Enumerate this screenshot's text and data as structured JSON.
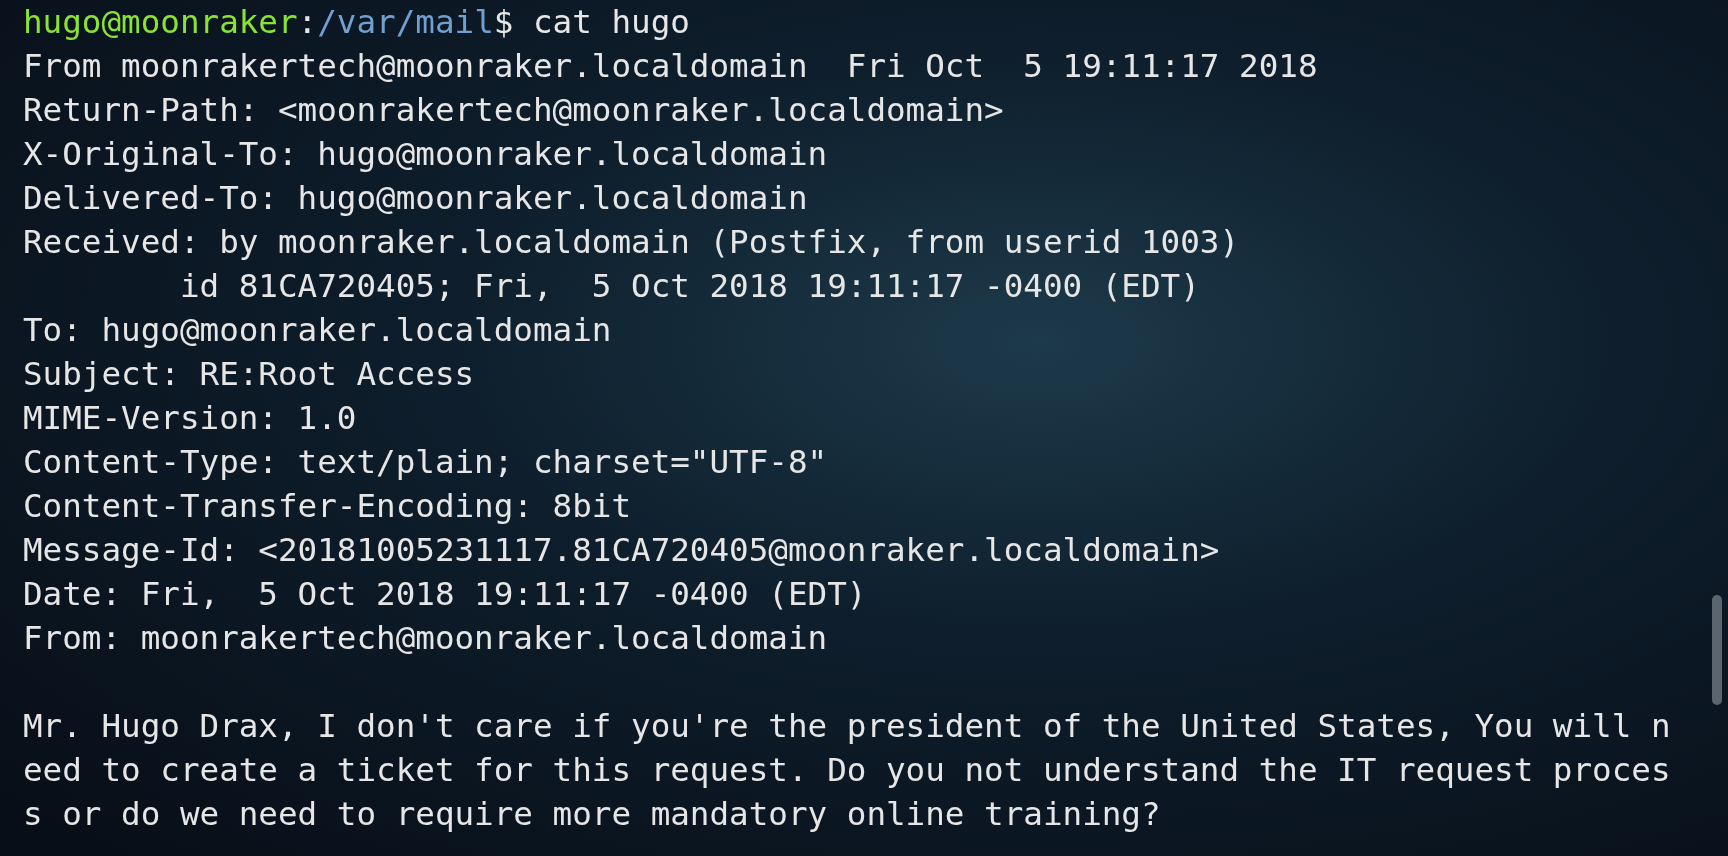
{
  "prompt": {
    "user_host": "hugo@moonraker",
    "separator": ":",
    "path": "/var/mail",
    "symbol": "$",
    "command": "cat hugo"
  },
  "output_lines": [
    "From moonrakertech@moonraker.localdomain  Fri Oct  5 19:11:17 2018",
    "Return-Path: <moonrakertech@moonraker.localdomain>",
    "X-Original-To: hugo@moonraker.localdomain",
    "Delivered-To: hugo@moonraker.localdomain",
    "Received: by moonraker.localdomain (Postfix, from userid 1003)",
    "        id 81CA720405; Fri,  5 Oct 2018 19:11:17 -0400 (EDT)",
    "To: hugo@moonraker.localdomain",
    "Subject: RE:Root Access",
    "MIME-Version: 1.0",
    "Content-Type: text/plain; charset=\"UTF-8\"",
    "Content-Transfer-Encoding: 8bit",
    "Message-Id: <20181005231117.81CA720405@moonraker.localdomain>",
    "Date: Fri,  5 Oct 2018 19:11:17 -0400 (EDT)",
    "From: moonrakertech@moonraker.localdomain"
  ],
  "message_body": "Mr. Hugo Drax, I don't care if you're the president of the United States, You will need to create a ticket for this request. Do you not understand the IT request process or do we need to require more mandatory online training?"
}
